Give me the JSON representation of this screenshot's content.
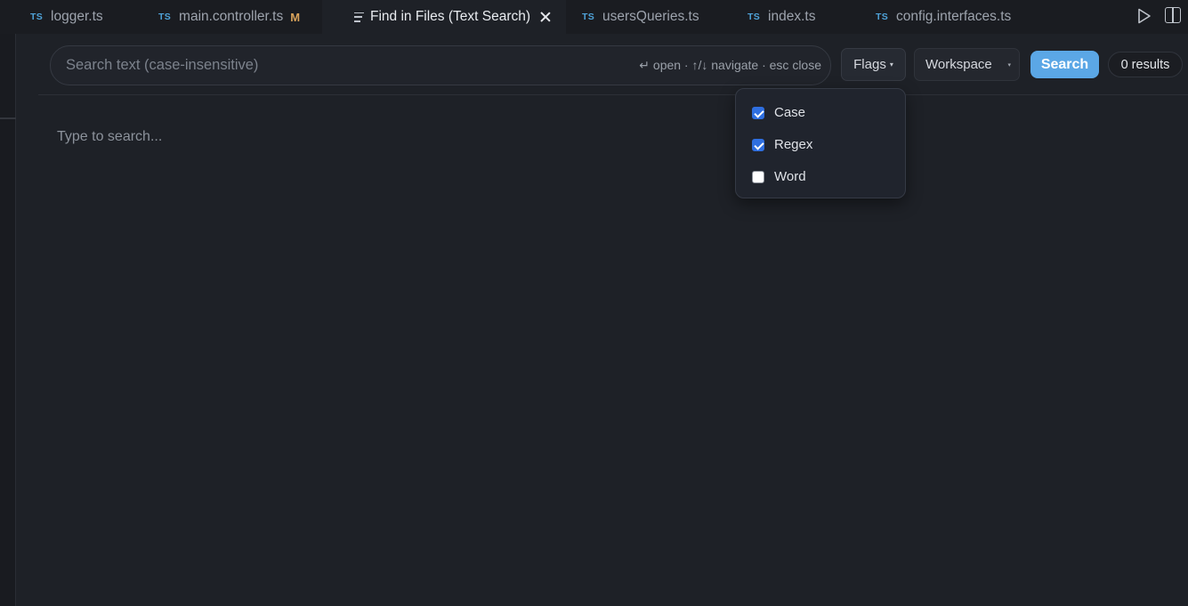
{
  "tabs": [
    {
      "lang": "TS",
      "label": "logger.ts"
    },
    {
      "lang": "TS",
      "label": "main.controller.ts",
      "badge": "M"
    },
    {
      "label": "Find in Files (Text Search)"
    },
    {
      "lang": "TS",
      "label": "usersQueries.ts"
    },
    {
      "lang": "TS",
      "label": "index.ts"
    },
    {
      "lang": "TS",
      "label": "config.interfaces.ts"
    }
  ],
  "search": {
    "placeholder": "Search text (case-insensitive)",
    "value": "",
    "hint": "↵ open · ↑/↓ navigate · esc close"
  },
  "toolbar": {
    "flags_label": "Flags",
    "flags_caret": "▾",
    "scope_value": "Workspace",
    "scope_caret": "▾",
    "search_label": "Search",
    "results": "0 results"
  },
  "flags_menu": {
    "items": [
      {
        "label": "Case",
        "checked": true
      },
      {
        "label": "Regex",
        "checked": true
      },
      {
        "label": "Word",
        "checked": false
      }
    ]
  },
  "main": {
    "empty_text": "Type to search..."
  },
  "colors": {
    "accent": "#5ba7e6",
    "checkbox": "#2f6fe0",
    "ts_badge": "#4fa3d9",
    "modified": "#d9a35b"
  }
}
